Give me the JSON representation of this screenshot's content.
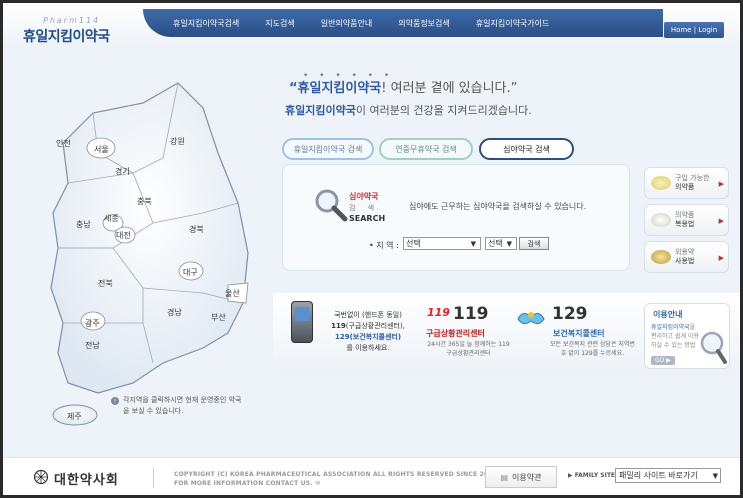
{
  "header": {
    "logo_sub": "Pharm114",
    "logo": "휴일지킴이약국",
    "nav": [
      "휴일지킴이약국검색",
      "지도검색",
      "일반의약품안내",
      "의약품정보검색",
      "휴일지킴이약국가이드"
    ],
    "login": "Home | Login"
  },
  "slogan": {
    "dots": "• • • • • •",
    "line1_highlight": "“휴일지킴이약국",
    "line1_rest": "! 여러분 곁에 있습니다.”",
    "line2_highlight": "휴일지킴이약국",
    "line2_rest": "이 여러분의 건강을 지켜드리겠습니다."
  },
  "tabs": [
    "휴일지킴이약국 검색",
    "연중무휴약국 검색",
    "심야약국 검색"
  ],
  "search": {
    "title": "심야약국",
    "sub": "검 색",
    "search_en": "SEARCH",
    "desc": "심야에도 근무하는 심야약국을 검색하실 수 있습니다.",
    "region_label": "• 지 역 :",
    "select1": "선택",
    "select2": "선택",
    "button": "검색"
  },
  "side_buttons": [
    {
      "top": "구입 가능한",
      "main": "의약품"
    },
    {
      "top": "의약품",
      "main": "복용법"
    },
    {
      "top": "외용약",
      "main": "사용법"
    }
  ],
  "map": {
    "regions": [
      "인천",
      "서울",
      "경기",
      "강원",
      "충북",
      "충남",
      "세종",
      "대전",
      "경북",
      "대구",
      "전북",
      "울산",
      "경남",
      "부산",
      "광주",
      "전남",
      "제주"
    ],
    "note": "각지역을 클릭하시면 현재 운영중인 약국을 보실 수 있습니다."
  },
  "band": {
    "phone_line1": "국번없이 (핸드폰 동일)",
    "phone_line2_num": "119",
    "phone_line2_rest": "(구급상황관리센터),",
    "phone_line3": "129(보건복지콜센터)",
    "phone_line4": "를 이용하세요.",
    "c119_logo": "119",
    "c119_num": "119",
    "c119_title": "구급상황관리센터",
    "c119_desc": "24시간 365일 늘 함께하는 119 구급상황관리센터",
    "c129_num": "129",
    "c129_title": "보건복지콜센터",
    "c129_desc": "모든 보건복지 관련 상담은 지역번호 없이 129를 누르세요.",
    "guide_title": "이용안내",
    "guide_desc_hl": "휴일지킴이약국",
    "guide_desc": "을 편리하고 쉽게 이용하실 수 있는 방법",
    "guide_go": "GO ▶"
  },
  "footer": {
    "logo": "대한약사회",
    "copy1": "COPYRIGHT (C) KOREA PHARMACEUTICAL ASSOCIATION ALL RIGHTS RESERVED SINCE 2005",
    "copy2": "FOR MORE INFORMATION CONTACT US.",
    "terms": "이용약관",
    "family_label": "▶ FAMILY SITE",
    "family_select": "패밀리 사이트 바로가기"
  }
}
